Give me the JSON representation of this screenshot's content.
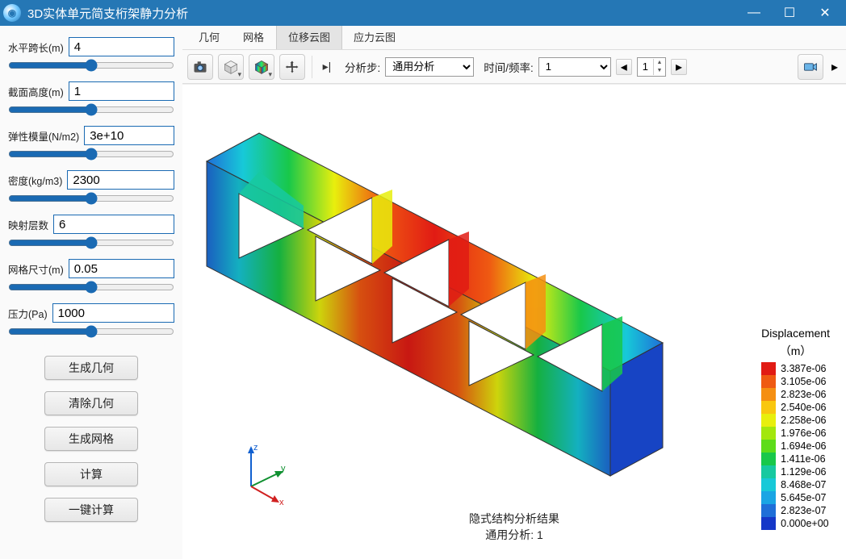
{
  "window": {
    "title": "3D实体单元简支桁架静力分析"
  },
  "params": [
    {
      "label": "水平跨长(m)",
      "value": "4"
    },
    {
      "label": "截面高度(m)",
      "value": "1"
    },
    {
      "label": "弹性模量(N/m2)",
      "value": "3e+10"
    },
    {
      "label": "密度(kg/m3)",
      "value": "2300"
    },
    {
      "label": "映射层数",
      "value": "6"
    },
    {
      "label": "网格尺寸(m)",
      "value": "0.05"
    },
    {
      "label": "压力(Pa)",
      "value": "1000"
    }
  ],
  "buttons": {
    "gen_geom": "生成几何",
    "clear_geom": "清除几何",
    "gen_mesh": "生成网格",
    "compute": "计算",
    "one_click": "一键计算"
  },
  "tabs": [
    {
      "label": "几何"
    },
    {
      "label": "网格"
    },
    {
      "label": "位移云图",
      "active": true
    },
    {
      "label": "应力云图"
    }
  ],
  "toolbar": {
    "collapse": "▸|",
    "step_label": "分析步:",
    "step_value": "通用分析",
    "time_label": "时间/频率:",
    "time_value": "1",
    "frame_value": "1"
  },
  "result_caption": {
    "l1": "隐式结构分析结果",
    "l2": "通用分析: 1"
  },
  "legend": {
    "title": "Displacement",
    "unit": "（m）",
    "items": [
      {
        "c": "#e11b14",
        "v": "3.387e-06"
      },
      {
        "c": "#ef5a12",
        "v": "3.105e-06"
      },
      {
        "c": "#f58f12",
        "v": "2.823e-06"
      },
      {
        "c": "#f9c70f",
        "v": "2.540e-06"
      },
      {
        "c": "#e8ef0d",
        "v": "2.258e-06"
      },
      {
        "c": "#a3e70d",
        "v": "1.976e-06"
      },
      {
        "c": "#5ddc1a",
        "v": "1.694e-06"
      },
      {
        "c": "#18c84a",
        "v": "1.411e-06"
      },
      {
        "c": "#17c9a0",
        "v": "1.129e-06"
      },
      {
        "c": "#17c9d8",
        "v": "8.468e-07"
      },
      {
        "c": "#1aa5e4",
        "v": "5.645e-07"
      },
      {
        "c": "#1f6fd8",
        "v": "2.823e-07"
      },
      {
        "c": "#1537c8",
        "v": "0.000e+00"
      }
    ]
  },
  "axes": {
    "x": "x",
    "y": "y",
    "z": "z"
  },
  "chart_data": {
    "type": "3d_contour",
    "quantity": "Displacement",
    "unit": "m",
    "range": [
      0.0,
      3.387e-06
    ],
    "contour_levels": [
      0.0,
      2.823e-07,
      5.645e-07,
      8.468e-07,
      1.129e-06,
      1.411e-06,
      1.694e-06,
      1.976e-06,
      2.258e-06,
      2.54e-06,
      2.823e-06,
      3.105e-06,
      3.387e-06
    ],
    "geometry": "simply-supported truss beam with triangular web cutouts",
    "analysis_step": "通用分析",
    "frame": 1
  }
}
